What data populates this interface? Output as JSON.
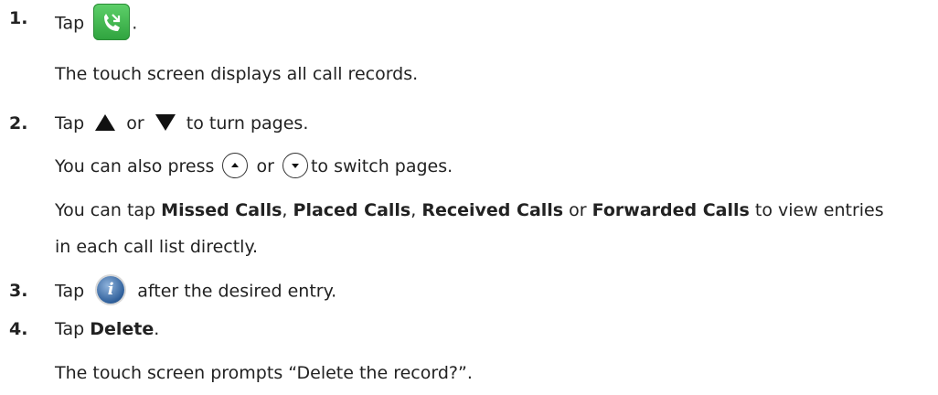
{
  "steps": [
    {
      "num": "1.",
      "tap": "Tap",
      "after_icon": ".",
      "note": "The touch screen displays all call records."
    },
    {
      "num": "2.",
      "tap": "Tap",
      "or": "or",
      "rest": "to turn pages.",
      "alt_a": "You can also press",
      "alt_or": "or",
      "alt_b": "to switch pages.",
      "tip_a": "You can tap",
      "missed": "Missed Calls",
      "sep1": ",",
      "placed": "Placed Calls",
      "sep2": ",",
      "received": "Received Calls",
      "tip_or": "or",
      "forwarded": "Forwarded Calls",
      "tip_b": "to view entries",
      "tip_c": "in each call list directly."
    },
    {
      "num": "3.",
      "tap": "Tap",
      "rest": "after the desired entry."
    },
    {
      "num": "4.",
      "tap": "Tap",
      "bold": "Delete",
      "end": ".",
      "note": "The touch screen prompts “Delete the record?”."
    }
  ],
  "icons": {
    "history": "call-history-icon",
    "up": "up-triangle-icon",
    "down": "down-triangle-icon",
    "key_up": "up-key-icon",
    "key_down": "down-key-icon",
    "info": "info-icon"
  },
  "colors": {
    "history_icon": "#3dbb4c",
    "info_icon": "#3a6aa5"
  }
}
